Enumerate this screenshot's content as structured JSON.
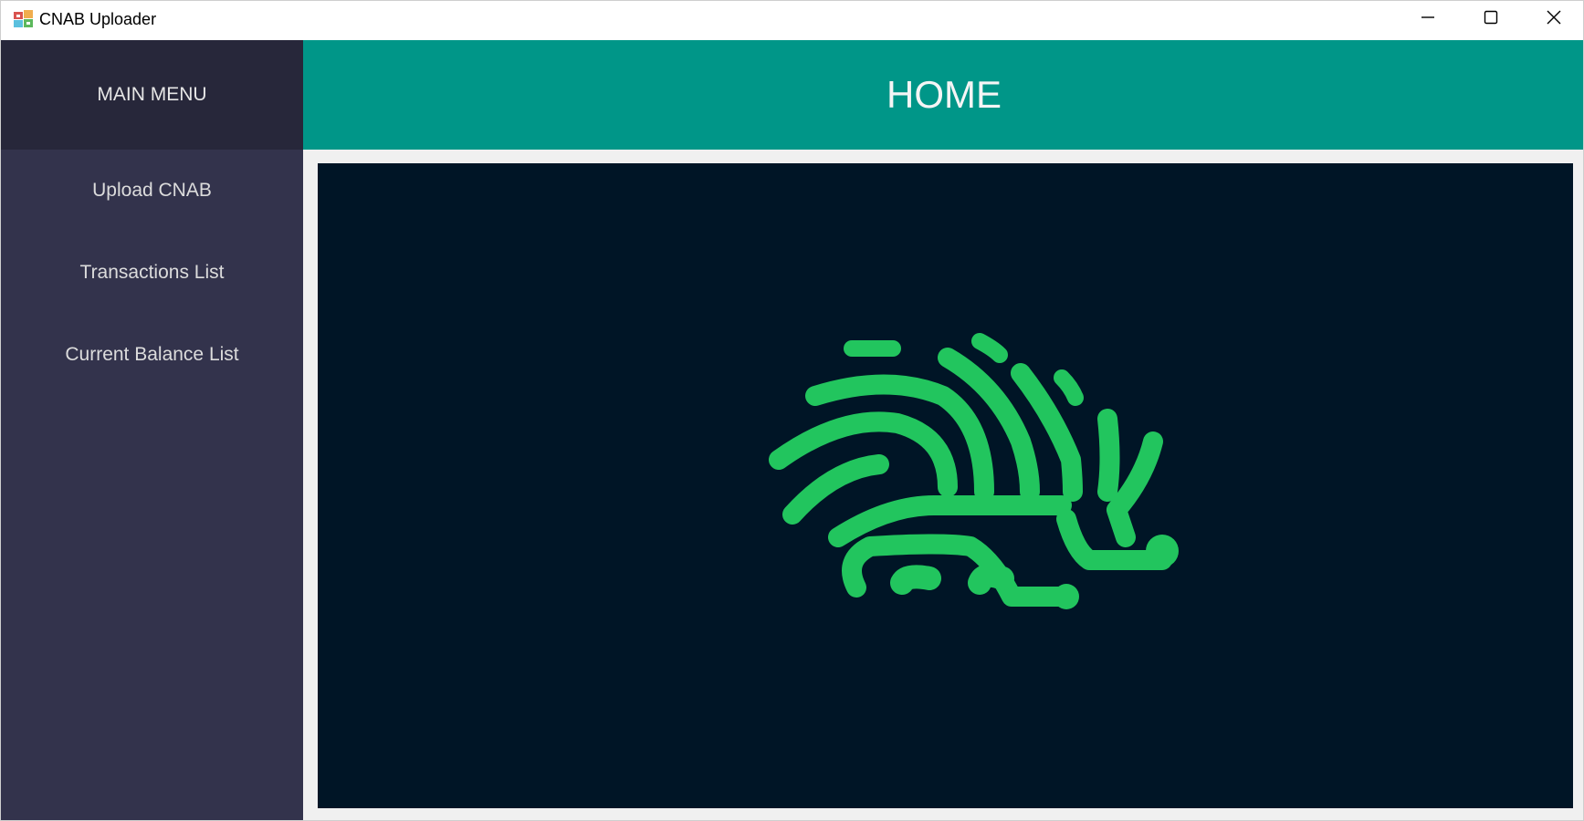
{
  "window": {
    "title": "CNAB Uploader",
    "app_icon": "app-icon"
  },
  "caption_buttons": {
    "minimize_icon": "minimize-icon",
    "maximize_icon": "maximize-icon",
    "close_icon": "close-icon"
  },
  "sidebar": {
    "header": "MAIN MENU",
    "items": [
      {
        "label": "Upload CNAB"
      },
      {
        "label": "Transactions List"
      },
      {
        "label": "Current Balance List"
      }
    ]
  },
  "main": {
    "header_title": "HOME",
    "logo_icon": "hedgehog-logo-icon"
  },
  "colors": {
    "sidebar_bg": "#33334c",
    "sidebar_header_bg": "#27273a",
    "header_bg": "#009688",
    "panel_bg": "#001526",
    "logo_green": "#22c55e"
  }
}
